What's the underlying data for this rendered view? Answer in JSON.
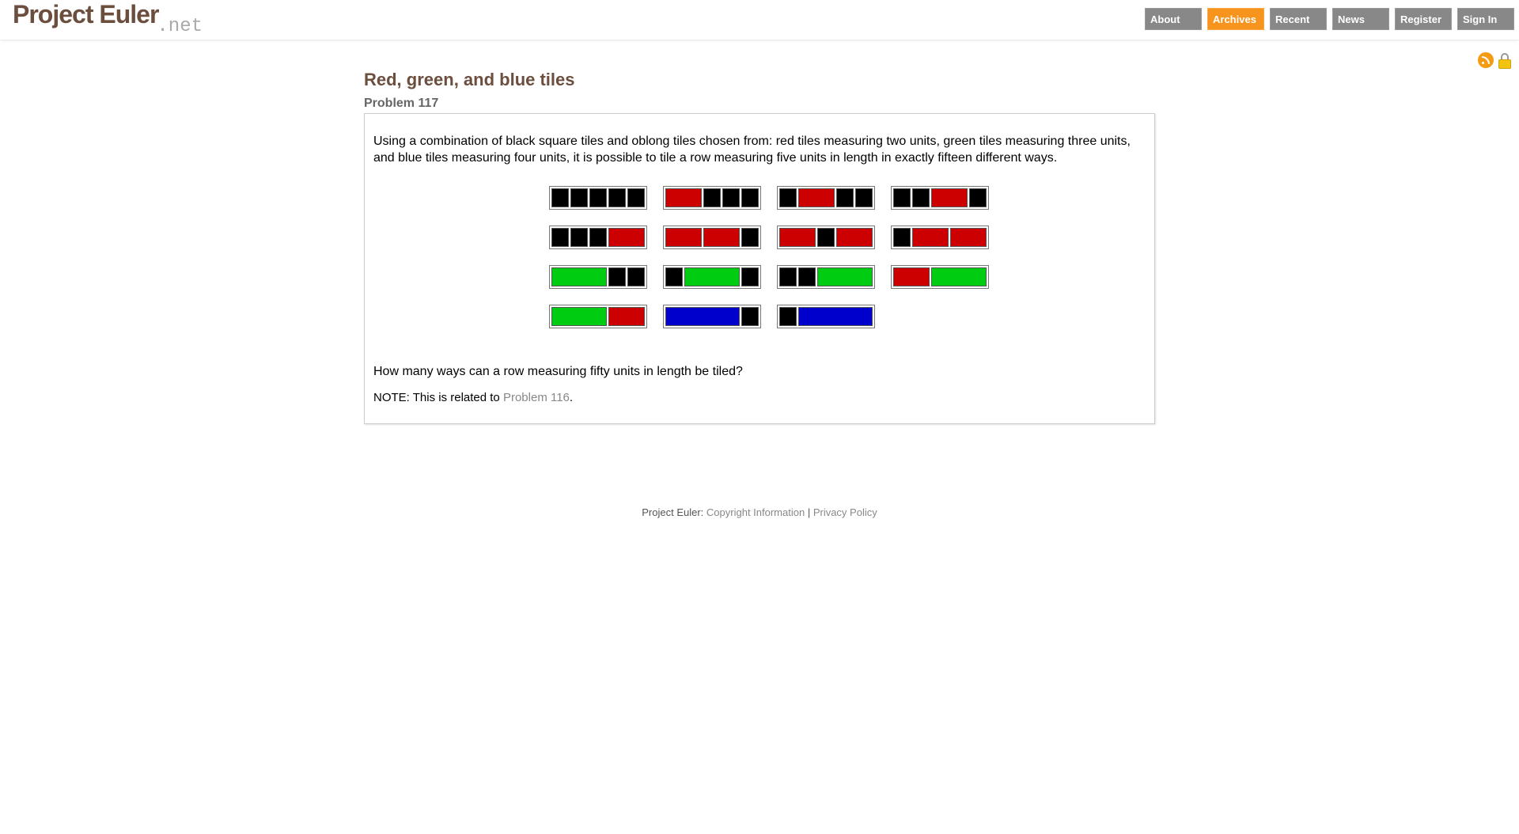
{
  "header": {
    "logo_main": "Project Euler",
    "logo_net": ".net",
    "nav": [
      {
        "label": "About",
        "active": false
      },
      {
        "label": "Archives",
        "active": true
      },
      {
        "label": "Recent",
        "active": false
      },
      {
        "label": "News",
        "active": false
      },
      {
        "label": "Register",
        "active": false
      },
      {
        "label": "Sign In",
        "active": false
      }
    ]
  },
  "problem": {
    "title": "Red, green, and blue tiles",
    "subtitle": "Problem 117",
    "paragraph": "Using a combination of black square tiles and oblong tiles chosen from: red tiles measuring two units, green tiles measuring three units, and blue tiles measuring four units, it is possible to tile a row measuring five units in length in exactly fifteen different ways.",
    "question": "How many ways can a row measuring fifty units in length be tiled?",
    "note_prefix": "NOTE: This is related to ",
    "note_link": "Problem 116",
    "note_suffix": "."
  },
  "tilings": [
    [
      "black",
      "black",
      "black",
      "black",
      "black"
    ],
    [
      "red",
      "black",
      "black",
      "black"
    ],
    [
      "black",
      "red",
      "black",
      "black"
    ],
    [
      "black",
      "black",
      "red",
      "black"
    ],
    [
      "black",
      "black",
      "black",
      "red"
    ],
    [
      "red",
      "red",
      "black"
    ],
    [
      "red",
      "black",
      "red"
    ],
    [
      "black",
      "red",
      "red"
    ],
    [
      "green",
      "black",
      "black"
    ],
    [
      "black",
      "green",
      "black"
    ],
    [
      "black",
      "black",
      "green"
    ],
    [
      "red",
      "green"
    ],
    [
      "green",
      "red"
    ],
    [
      "blue",
      "black"
    ],
    [
      "black",
      "blue"
    ]
  ],
  "colors": {
    "title": "#6b4e3d",
    "nav_active": "#f7941d",
    "nav": "#888888",
    "black": "#000000",
    "red": "#cc0000",
    "green": "#00cc11",
    "blue": "#0000cc"
  },
  "icons": [
    "rss-icon",
    "lock-icon"
  ],
  "footer": {
    "prefix": "Project Euler: ",
    "copyright": "Copyright Information",
    "separator": " | ",
    "privacy": "Privacy Policy"
  }
}
